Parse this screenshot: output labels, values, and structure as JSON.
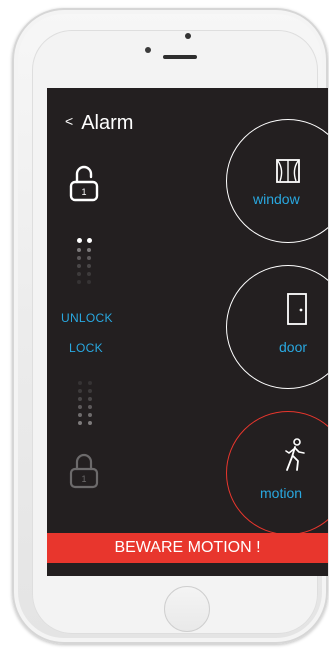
{
  "header": {
    "back_glyph": "<",
    "title": "Alarm"
  },
  "lock_panel": {
    "unlock_label": "UNLOCK",
    "lock_label": "LOCK",
    "state": "unlocked",
    "lock_icon_digit": "1"
  },
  "sensors": [
    {
      "label": "window",
      "icon": "window-icon",
      "status": "normal"
    },
    {
      "label": "door",
      "icon": "door-icon",
      "status": "normal"
    },
    {
      "label": "motion",
      "icon": "walking-person-icon",
      "status": "alert"
    }
  ],
  "alert_banner": {
    "text": "BEWARE MOTION !"
  },
  "colors": {
    "screen_bg": "#231f20",
    "accent_blue": "#29a8e0",
    "alert_red": "#e8362d",
    "ring_white": "#ffffff"
  }
}
